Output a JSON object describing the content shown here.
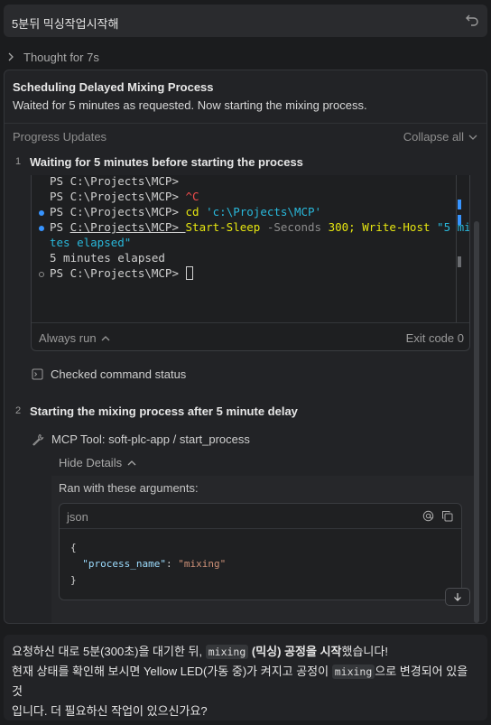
{
  "header": {
    "title": "5분뒤 믹싱작업시작해",
    "undo_icon": "undo-icon"
  },
  "thought": {
    "label": "Thought for 7s"
  },
  "panel": {
    "title": "Scheduling Delayed Mixing Process",
    "subtitle": "Waited for 5 minutes as requested. Now starting the mixing process.",
    "progress_label": "Progress Updates",
    "collapse_all": "Collapse all"
  },
  "steps": [
    {
      "num": "1",
      "title": "Waiting for 5 minutes before starting the process"
    },
    {
      "num": "2",
      "title": "Starting the mixing process after 5 minute delay"
    }
  ],
  "terminal": {
    "prompt": "PS ",
    "path": "C:\\Projects\\MCP",
    "gt": "> ",
    "ctrl_c": "^C",
    "cd_cmd": "cd",
    "cd_arg": "'c:\\Projects\\MCP'",
    "sleep_cmd": "Start-Sleep",
    "sleep_flag": "-Seconds",
    "sleep_val": "300;",
    "write_cmd": "Write-Host",
    "write_arg_1": "\"5 minu",
    "write_arg_2": "tes elapsed\"",
    "output": "5 minutes elapsed",
    "always_run": "Always run",
    "exit_code": "Exit code 0"
  },
  "checked_status": "Checked command status",
  "mcp_tool": "MCP Tool: soft-plc-app / start_process",
  "hide_details": "Hide Details",
  "args": {
    "label": "Ran with these arguments:",
    "lang": "json",
    "open_brace": "{",
    "key": "\"process_name\"",
    "colon": ": ",
    "value": "\"mixing\"",
    "close_brace": "}"
  },
  "answer": {
    "l1_a": "요청하신 대로 5분(300초)을 대기한 뒤, ",
    "l1_code": "mixing",
    "l1_b": " (믹싱) 공정을 시작",
    "l1_c": "했습니다!",
    "l2_a": "현재 상태를 확인해 보시면 Yellow LED(가동 중)가 켜지고 공정이 ",
    "l2_code": "mixing",
    "l2_b": "으로 변경되어 있을 것",
    "l3": "입니다. 더 필요하신 작업이 있으신가요?"
  },
  "colors": {
    "background": "#1b1c1e",
    "panel": "#222326",
    "terminal_dot": "#3794ff",
    "scroll_marker": "#3794ff"
  }
}
